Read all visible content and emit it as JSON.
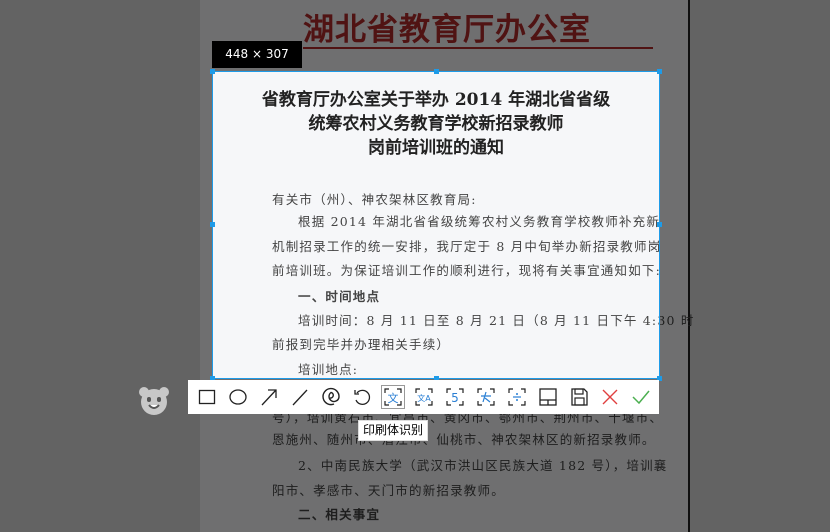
{
  "document": {
    "header": "湖北省教育厅办公室",
    "title_lines": [
      "省教育厅办公室关于举办 2014 年湖北省省级",
      "统筹农村义务教育学校新招录教师",
      "岗前培训班的通知"
    ],
    "body_lines": [
      "有关市（州）、神农架林区教育局:",
      "根据 2014 年湖北省省级统筹农村义务教育学校教师补充新",
      "机制招录工作的统一安排，我厅定于 8 月中旬举办新招录教师岗",
      "前培训班。为保证培训工作的顺利进行，现将有关事宜通知如下:",
      "一、时间地点",
      "培训时间：8 月 11 日至 8 月 21 日（8 月 11 日下午 4:30 时",
      "前报到完毕并办理相关手续）",
      "培训地点:",
      "号），培训黄石市、宜昌市、黄冈市、鄂州市、荆州市、十堰市、",
      "恩施州、随州市、潜江市、仙桃市、神农架林区的新招录教师。",
      "2、中南民族大学（武汉市洪山区民族大道 182 号），培训襄",
      "阳市、孝感市、天门市的新招录教师。",
      "二、相关事宜"
    ]
  },
  "capture": {
    "size_label": "448 × 307",
    "accent_color": "#1e9be8"
  },
  "toolbar": {
    "tools": [
      {
        "name": "rectangle-tool",
        "icon": "rectangle-icon"
      },
      {
        "name": "ellipse-tool",
        "icon": "ellipse-icon"
      },
      {
        "name": "arrow-tool",
        "icon": "arrow-icon"
      },
      {
        "name": "line-tool",
        "icon": "line-icon"
      },
      {
        "name": "pen-tool",
        "icon": "spiral-icon"
      },
      {
        "name": "undo-tool",
        "icon": "undo-icon"
      },
      {
        "name": "print-ocr-tool",
        "icon": "ocr-text-icon"
      },
      {
        "name": "translate-tool",
        "icon": "translate-icon"
      },
      {
        "name": "number-ocr-tool",
        "icon": "number-ocr-icon"
      },
      {
        "name": "handwriting-ocr-tool",
        "icon": "handwriting-icon"
      },
      {
        "name": "formula-ocr-tool",
        "icon": "formula-icon"
      },
      {
        "name": "table-ocr-tool",
        "icon": "table-icon"
      },
      {
        "name": "save-button",
        "icon": "save-icon"
      },
      {
        "name": "cancel-button",
        "icon": "close-icon"
      },
      {
        "name": "confirm-button",
        "icon": "check-icon"
      }
    ],
    "tooltip": "印刷体识别"
  }
}
